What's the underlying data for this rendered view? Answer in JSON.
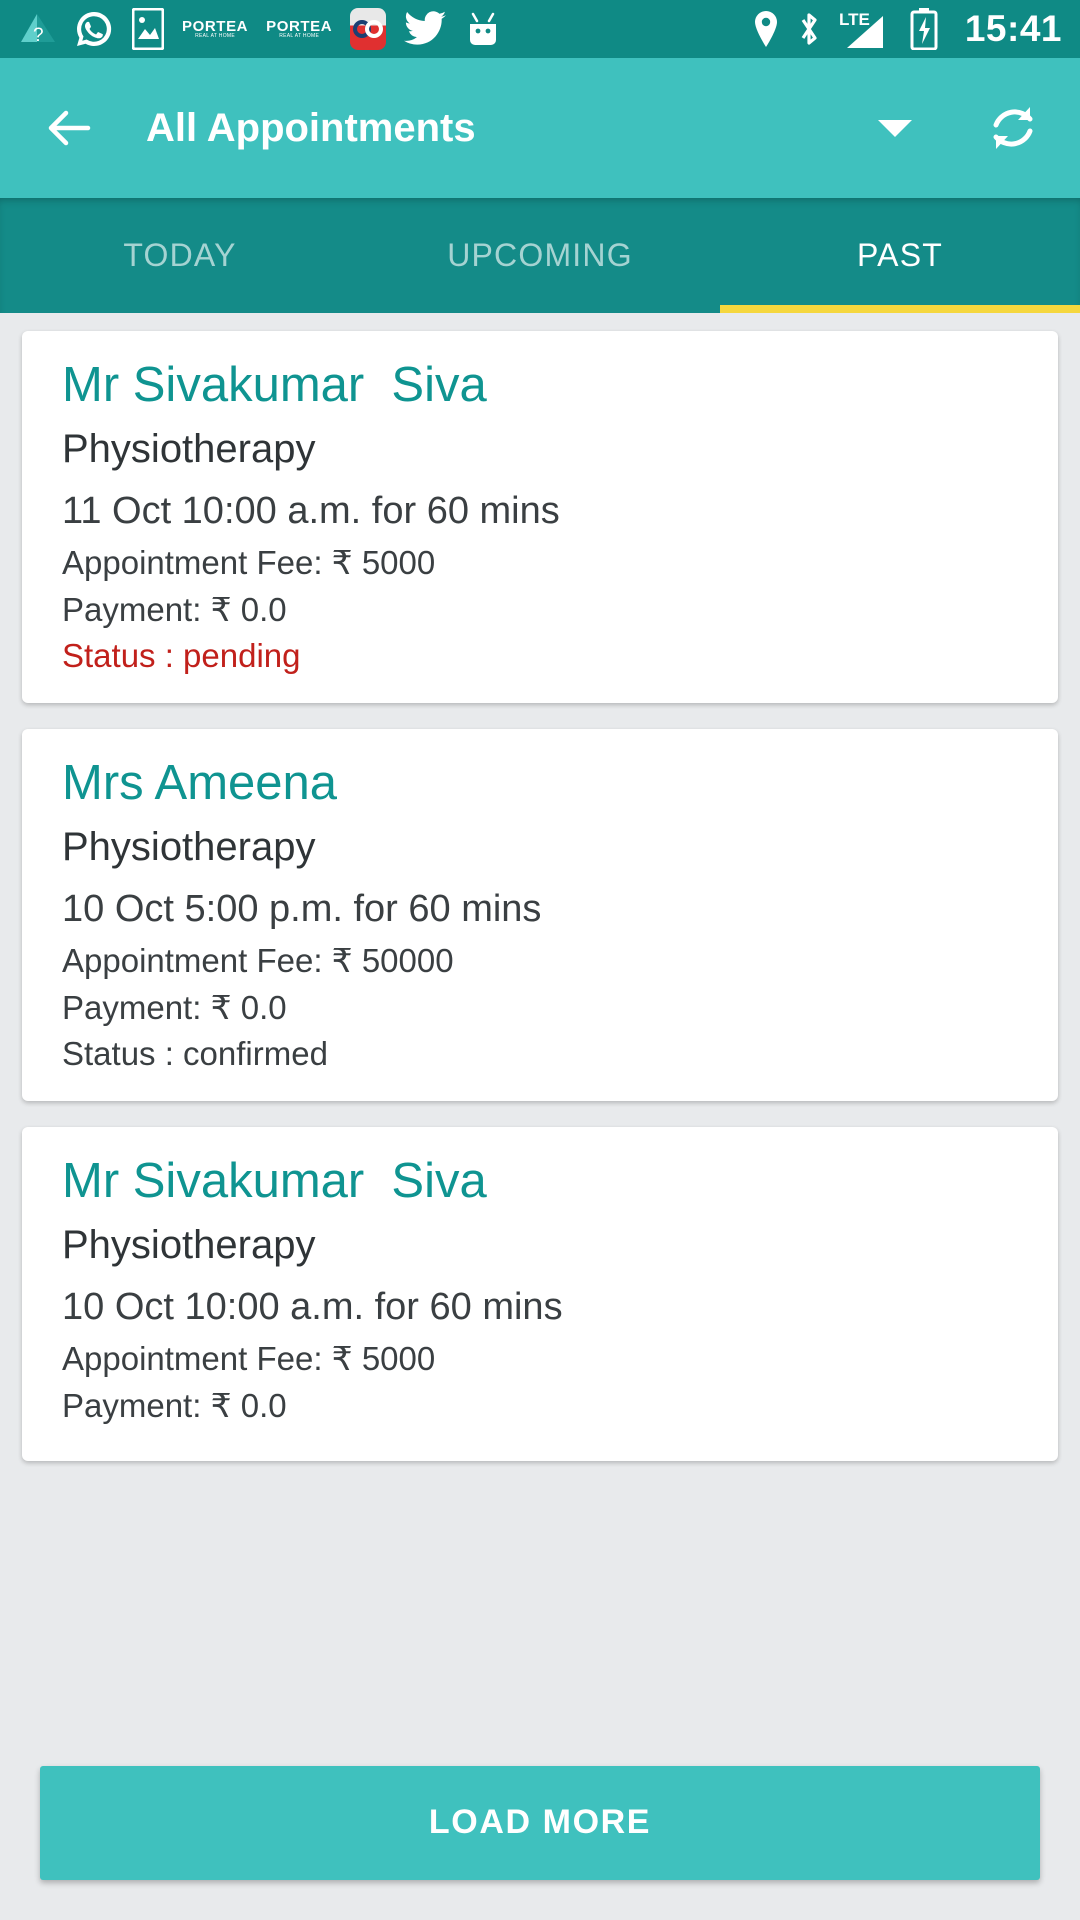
{
  "statusbar": {
    "clock": "15:41",
    "left_icons": [
      {
        "name": "wifi-unknown-icon",
        "glyph": "?"
      },
      {
        "name": "whatsapp-icon",
        "glyph": ""
      },
      {
        "name": "gallery-icon",
        "glyph": ""
      },
      {
        "name": "portea-icon-1",
        "label": "PORTEA",
        "sub": "REAL AT HOME"
      },
      {
        "name": "portea-icon-2",
        "label": "PORTEA",
        "sub": "REAL AT HOME"
      },
      {
        "name": "app-red-icon",
        "glyph": "∞"
      },
      {
        "name": "twitter-icon",
        "glyph": ""
      },
      {
        "name": "android-icon",
        "glyph": ""
      }
    ],
    "right_icons": [
      {
        "name": "location-icon"
      },
      {
        "name": "bluetooth-icon"
      },
      {
        "name": "lte-signal-icon",
        "label": "LTE"
      },
      {
        "name": "battery-charging-icon"
      }
    ]
  },
  "appbar": {
    "title": "All Appointments",
    "back_label": "Back",
    "dropdown_label": "Filter",
    "refresh_label": "Refresh"
  },
  "tabs": {
    "items": [
      {
        "label": "TODAY",
        "active": false
      },
      {
        "label": "UPCOMING",
        "active": false
      },
      {
        "label": "PAST",
        "active": true
      }
    ],
    "indicator_color": "#f5d73e"
  },
  "appointments": [
    {
      "name": "Mr Sivakumar  Siva",
      "service": "Physiotherapy",
      "when": "11 Oct 10:00 a.m. for 60 mins",
      "fee": "Appointment Fee: ₹ 5000",
      "payment": "Payment: ₹ 0.0",
      "status": "Status : pending",
      "status_kind": "pending"
    },
    {
      "name": "Mrs Ameena",
      "service": "Physiotherapy",
      "when": "10 Oct 5:00 p.m. for 60 mins",
      "fee": "Appointment Fee: ₹ 50000",
      "payment": "Payment: ₹ 0.0",
      "status": "Status : confirmed",
      "status_kind": "normal"
    },
    {
      "name": "Mr Sivakumar  Siva",
      "service": "Physiotherapy",
      "when": "10 Oct 10:00 a.m. for 60 mins",
      "fee": "Appointment Fee: ₹ 5000",
      "payment": "Payment: ₹ 0.0",
      "status": "",
      "status_kind": "normal"
    }
  ],
  "footer": {
    "load_more_label": "LOAD MORE"
  },
  "colors": {
    "status_bar": "#0f8a85",
    "app_bar": "#3fc1be",
    "tab_bar": "#148b88",
    "accent_teal": "#0f9491",
    "pending_red": "#c1201b",
    "page_bg": "#e8eaec"
  }
}
